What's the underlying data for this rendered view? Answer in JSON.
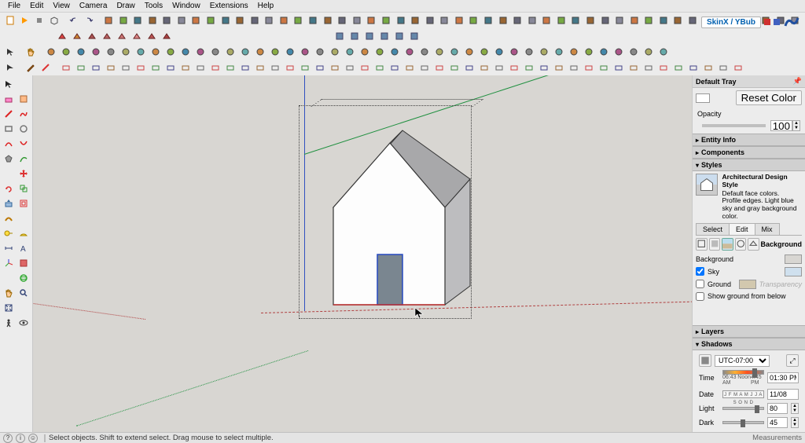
{
  "menu": {
    "items": [
      "File",
      "Edit",
      "View",
      "Camera",
      "Draw",
      "Tools",
      "Window",
      "Extensions",
      "Help"
    ]
  },
  "branding": {
    "text": "SkinX / YBub"
  },
  "tray": {
    "title": "Default Tray",
    "reset_color": "Reset Color",
    "opacity_label": "Opacity",
    "opacity_value": "100",
    "panels": {
      "entity_info": "Entity Info",
      "components": "Components",
      "styles": "Styles",
      "layers": "Layers",
      "shadows": "Shadows"
    },
    "style": {
      "name": "Architectural Design Style",
      "desc": "Default face colors. Profile edges. Light blue sky and gray background color."
    },
    "tabs": {
      "select": "Select",
      "edit": "Edit",
      "mix": "Mix"
    },
    "bg": {
      "heading": "Background",
      "background": "Background",
      "sky": "Sky",
      "ground": "Ground",
      "transparency": "Transparency",
      "show_ground": "Show ground from below"
    },
    "shadows": {
      "timezone": "UTC-07:00",
      "time_label": "Time",
      "time_min": "06:43 AM",
      "time_noon": "Noon",
      "time_max": "4:45 PM",
      "time_value": "01:30 PM",
      "date_label": "Date",
      "date_months": "J F M A M J J A S O N D",
      "date_value": "11/08",
      "light_label": "Light",
      "light_value": "80",
      "dark_label": "Dark",
      "dark_value": "45"
    }
  },
  "status": {
    "hint": "Select objects. Shift to extend select. Drag mouse to select multiple.",
    "measurements": "Measurements"
  }
}
